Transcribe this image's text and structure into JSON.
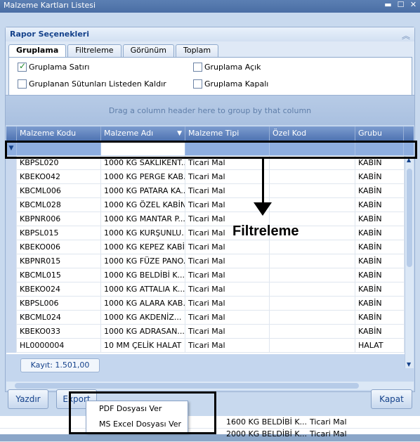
{
  "window": {
    "title": "Malzeme Kartları Listesi"
  },
  "options": {
    "title": "Rapor Seçenekleri",
    "tabs": [
      "Gruplama",
      "Filtreleme",
      "Görünüm",
      "Toplam"
    ],
    "checkboxes": [
      {
        "label": "Gruplama Satırı",
        "checked": true
      },
      {
        "label": "Gruplanan Sütunları Listeden Kaldır",
        "checked": false
      },
      {
        "label": "Gruplama Açık",
        "checked": false
      },
      {
        "label": "Gruplama Kapalı",
        "checked": false
      }
    ]
  },
  "grid": {
    "group_hint": "Drag a column header here to group by that column",
    "columns": [
      "Malzeme Kodu",
      "Malzeme Adı",
      "Malzeme Tipi",
      "Özel Kod",
      "Grubu"
    ],
    "rows": [
      [
        "KBPSL020",
        "1000 KG SAKLIKENT...",
        "Ticari Mal",
        "",
        "KABİN"
      ],
      [
        "KBEKO042",
        "1000 KG PERGE KAB...",
        "Ticari Mal",
        "",
        "KABİN"
      ],
      [
        "KBCML006",
        "1000 KG PATARA KA...",
        "Ticari Mal",
        "",
        "KABİN"
      ],
      [
        "KBCML028",
        "1000 KG ÖZEL KABİN",
        "Ticari Mal",
        "",
        "KABİN"
      ],
      [
        "KBPNR006",
        "1000 KG MANTAR P...",
        "Ticari Mal",
        "",
        "KABİN"
      ],
      [
        "KBPSL015",
        "1000 KG KURŞUNLU...",
        "Ticari Mal",
        "",
        "KABİN"
      ],
      [
        "KBEKO006",
        "1000 KG KEPEZ KABİN",
        "Ticari Mal",
        "",
        "KABİN"
      ],
      [
        "KBPNR015",
        "1000 KG FÜZE PANO...",
        "Ticari Mal",
        "",
        "KABİN"
      ],
      [
        "KBCML015",
        "1000 KG BELDİBİ  K...",
        "Ticari Mal",
        "",
        "KABİN"
      ],
      [
        "KBEKO024",
        "1000 KG ATTALIA K...",
        "Ticari Mal",
        "",
        "KABİN"
      ],
      [
        "KBPSL006",
        "1000 KG ALARA KAB...",
        "Ticari Mal",
        "",
        "KABİN"
      ],
      [
        "KBCML024",
        "1000 KG AKDENİZ...",
        "Ticari Mal",
        "",
        "KABİN"
      ],
      [
        "KBEKO033",
        "1000 KG ADRASAN...",
        "Ticari Mal",
        "",
        "KABİN"
      ],
      [
        "HL0000004",
        "10 MM ÇELİK HALAT",
        "Ticari Mal",
        "",
        "HALAT"
      ]
    ],
    "count": "Kayıt: 1.501,00"
  },
  "buttons": {
    "print": "Yazdır",
    "export": "Export",
    "close": "Kapat"
  },
  "export_menu": [
    "PDF Dosyası Ver",
    "MS Excel Dosyası Ver"
  ],
  "background_rows": [
    [
      "1600 KG BELDİBİ  K...",
      "Ticari Mal"
    ],
    [
      "2000 KG BELDİBİ  K...",
      "Ticari Mal"
    ]
  ],
  "annotation": "Filtreleme"
}
